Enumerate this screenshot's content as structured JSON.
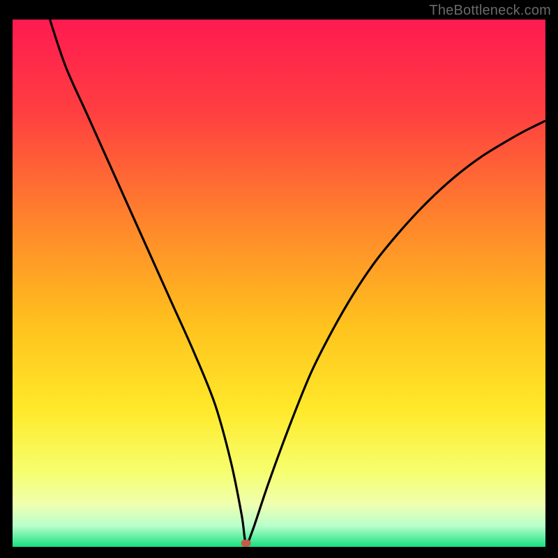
{
  "watermark": "TheBottleneck.com",
  "chart_data": {
    "type": "line",
    "title": "",
    "xlabel": "",
    "ylabel": "",
    "xlim": [
      0,
      100
    ],
    "ylim": [
      0,
      100
    ],
    "grid": false,
    "legend": false,
    "gradient_stops": [
      {
        "offset": 0,
        "color": "#ff1a51"
      },
      {
        "offset": 18,
        "color": "#ff4040"
      },
      {
        "offset": 40,
        "color": "#ff8a2a"
      },
      {
        "offset": 58,
        "color": "#ffc21e"
      },
      {
        "offset": 74,
        "color": "#ffe92a"
      },
      {
        "offset": 86,
        "color": "#f6ff70"
      },
      {
        "offset": 92,
        "color": "#efffb0"
      },
      {
        "offset": 96,
        "color": "#b8ffcc"
      },
      {
        "offset": 100,
        "color": "#18e07f"
      }
    ],
    "marker": {
      "x": 43.8,
      "y": 0.7,
      "color": "#c65a4a"
    },
    "series": [
      {
        "name": "curve",
        "x": [
          7,
          10,
          14,
          18,
          22,
          26,
          30,
          34,
          38,
          41,
          43,
          43.8,
          45,
          48,
          52,
          56,
          60,
          64,
          68,
          72,
          76,
          80,
          84,
          88,
          92,
          96,
          100
        ],
        "y": [
          100,
          91,
          82,
          73,
          64,
          55,
          46,
          37,
          27,
          16,
          6,
          0.7,
          3,
          12,
          23,
          33,
          41,
          48,
          54,
          59,
          63.5,
          67.5,
          71,
          74,
          76.5,
          78.8,
          80.8
        ]
      }
    ]
  }
}
